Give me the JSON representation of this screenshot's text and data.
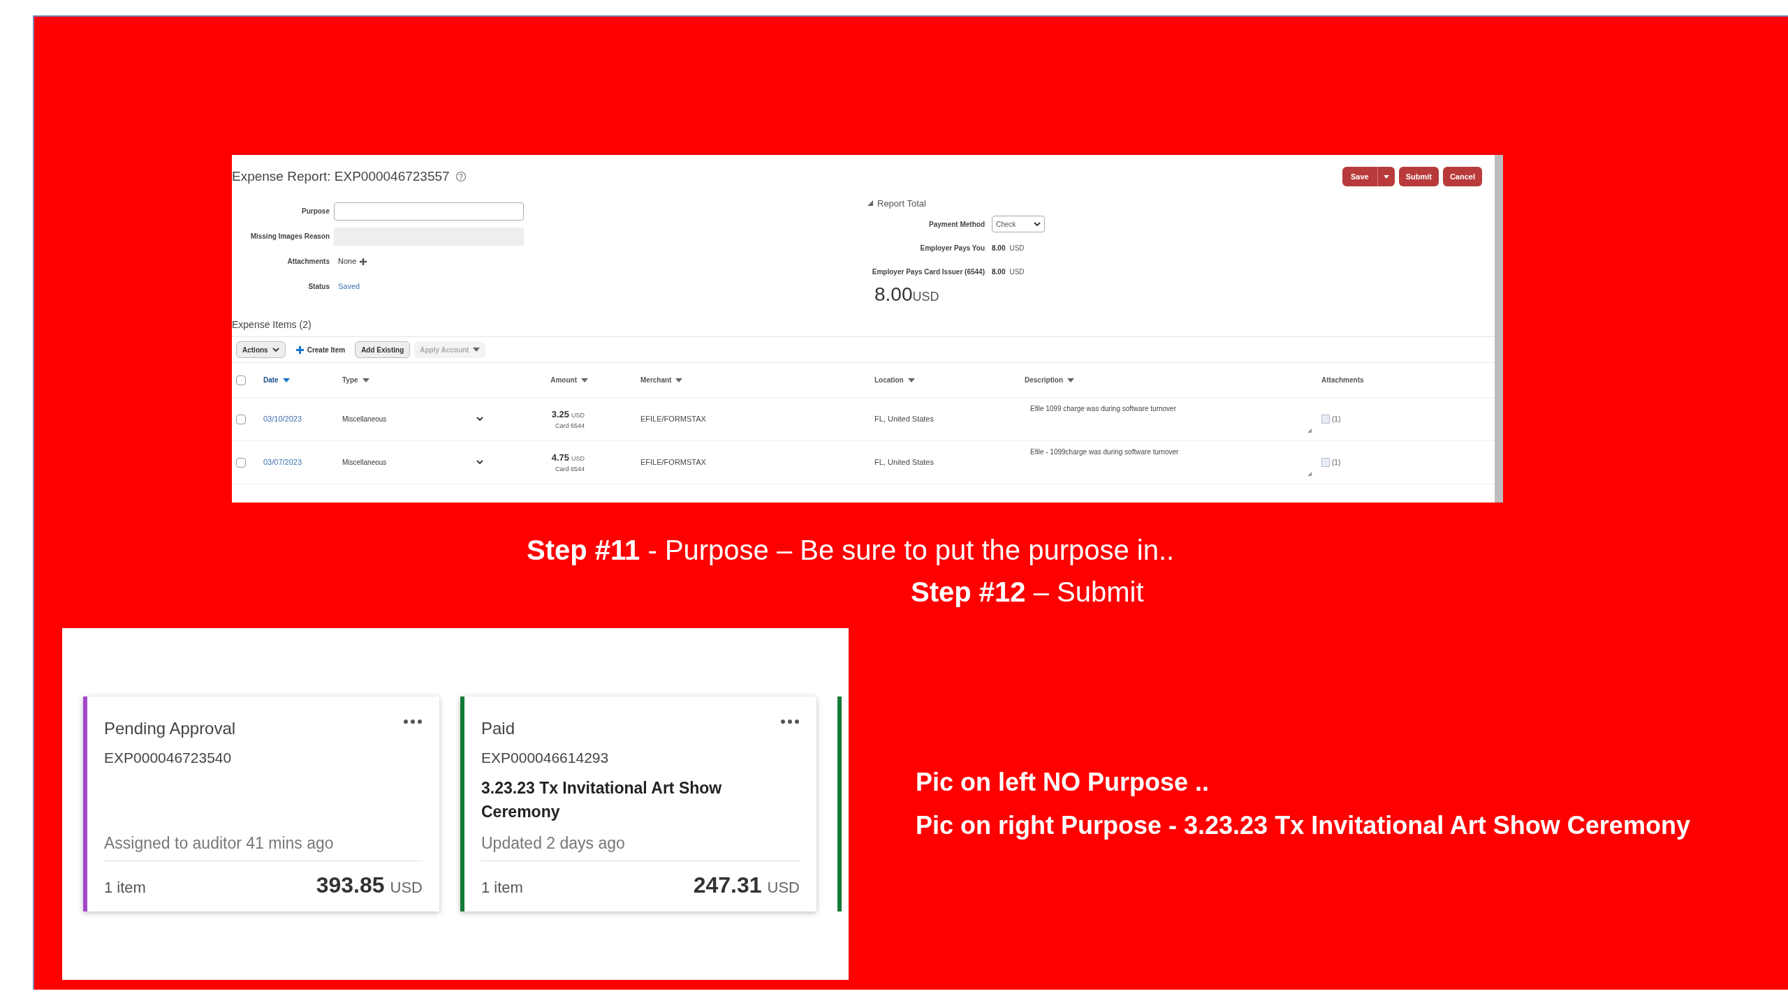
{
  "report": {
    "title": "Expense Report: EXP000046723557",
    "buttons": [
      {
        "label": "Save",
        "kind": "split"
      },
      {
        "label": "Submit",
        "kind": "plain"
      },
      {
        "label": "Cancel",
        "kind": "plain"
      }
    ],
    "fields": [
      {
        "label": "Purpose",
        "kind": "input"
      },
      {
        "label": "Missing Images Reason",
        "kind": "readonly"
      },
      {
        "label": "Attachments",
        "kind": "add",
        "value": "None"
      },
      {
        "label": "Status",
        "kind": "link",
        "value": "Saved"
      }
    ],
    "total": {
      "heading": "Report Total",
      "expanded": true,
      "fields": [
        {
          "label": "Payment Method",
          "kind": "select",
          "value": "Check"
        },
        {
          "label": "Employer Pays You",
          "kind": "amount",
          "value": "8.00",
          "currency": "USD"
        },
        {
          "label": "Employer Pays Card Issuer (6544)",
          "kind": "amount",
          "value": "8.00",
          "currency": "USD"
        }
      ],
      "amount": "8.00",
      "currency": "USD"
    },
    "items_heading": "Expense Items (2)",
    "toolbar": [
      {
        "label": "Actions",
        "kind": "menu",
        "disabled": false
      },
      {
        "label": "Create Item",
        "kind": "create",
        "disabled": false
      },
      {
        "label": "Add Existing",
        "kind": "button",
        "disabled": false
      },
      {
        "label": "Apply Account",
        "kind": "menu",
        "disabled": true
      }
    ],
    "header_checked": false,
    "columns": [
      {
        "label": "Date",
        "sortable": true,
        "sorted": true
      },
      {
        "label": "Type",
        "sortable": true,
        "sorted": false
      },
      {
        "label": "Amount",
        "sortable": true,
        "sorted": false
      },
      {
        "label": "Merchant",
        "sortable": true,
        "sorted": false
      },
      {
        "label": "Location",
        "sortable": true,
        "sorted": false
      },
      {
        "label": "Description",
        "sortable": true,
        "sorted": false
      },
      {
        "label": "Attachments",
        "sortable": false,
        "sorted": false
      }
    ],
    "rows": [
      {
        "checked": false,
        "date": "03/10/2023",
        "type": "Miscellaneous",
        "amount": "3.25",
        "currency": "USD",
        "card": "Card 6544",
        "merchant": "EFILE/FORMSTAX",
        "location": "FL, United States",
        "description": "Efile 1099 charge was during software turnover",
        "attachments": "(1)"
      },
      {
        "checked": false,
        "date": "03/07/2023",
        "type": "Miscellaneous",
        "amount": "4.75",
        "currency": "USD",
        "card": "Card 6544",
        "merchant": "EFILE/FORMSTAX",
        "location": "FL, United States",
        "description": "Efile - 1099charge was during software turnover",
        "attachments": "(1)"
      }
    ]
  },
  "steps": [
    "**Step #11** -  Purpose – Be sure to put the purpose in..",
    "**Step #12** – Submit"
  ],
  "cards": [
    {
      "status": "Pending Approval",
      "id": "EXP000046723540",
      "note": "Assigned to auditor 41 mins ago",
      "count": "1 item",
      "amount": "393.85",
      "currency": "USD",
      "color": "#a347c8"
    },
    {
      "status": "Paid",
      "id": "EXP000046614293",
      "purpose": "3.23.23 Tx Invitational Art Show Ceremony",
      "note": "Updated 2 days ago",
      "count": "1 item",
      "amount": "247.31",
      "currency": "USD",
      "color": "#117a35"
    },
    {
      "color": "#117a35"
    }
  ],
  "notes": [
    "Pic on left NO Purpose ..",
    "Pic on right Purpose  - 3.23.23 Tx Invitational Art Show Ceremony"
  ]
}
